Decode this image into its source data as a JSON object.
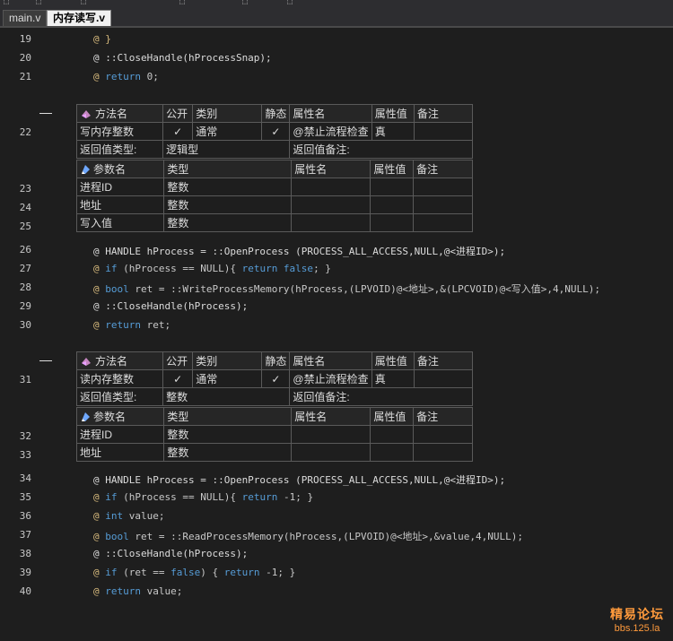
{
  "tabs": {
    "inactive": "main.v",
    "active": "内存读写.v"
  },
  "lines": {
    "l19": {
      "n": "19",
      "text": "@ }"
    },
    "l20": {
      "n": "20",
      "text": "@ ::CloseHandle(hProcessSnap);"
    },
    "l21": {
      "n": "21",
      "at": "@ ",
      "kw": "return",
      "rest": " 0;"
    },
    "l26": {
      "n": "26",
      "text": "@ HANDLE hProcess = ::OpenProcess (PROCESS_ALL_ACCESS,NULL,@<进程ID>);"
    },
    "l27": {
      "n": "27",
      "at": "@ ",
      "kw": "if",
      "mid": " (hProcess == NULL){ ",
      "kw2": "return false",
      "rest": "; }"
    },
    "l28": {
      "n": "28",
      "at": "@ ",
      "kw": "bool",
      "rest": " ret = ::WriteProcessMemory(hProcess,(LPVOID)@<地址>,&(LPCVOID)@<写入值>,4,NULL);"
    },
    "l29": {
      "n": "29",
      "text": "@ ::CloseHandle(hProcess);"
    },
    "l30": {
      "n": "30",
      "at": "@ ",
      "kw": "return",
      "rest": " ret;"
    },
    "l34": {
      "n": "34",
      "text": "@ HANDLE hProcess = ::OpenProcess (PROCESS_ALL_ACCESS,NULL,@<进程ID>);"
    },
    "l35": {
      "n": "35",
      "at": "@ ",
      "kw": "if",
      "mid": " (hProcess == NULL){ ",
      "kw2": "return",
      "rest": " -1; }"
    },
    "l36": {
      "n": "36",
      "at": "@ ",
      "kw": "int",
      "rest": " value;"
    },
    "l37": {
      "n": "37",
      "at": "@ ",
      "kw": "bool",
      "rest": " ret = ::ReadProcessMemory(hProcess,(LPVOID)@<地址>,&value,4,NULL);"
    },
    "l38": {
      "n": "38",
      "text": "@ ::CloseHandle(hProcess);"
    },
    "l39": {
      "n": "39",
      "at": "@ ",
      "kw": "if",
      "mid": " (ret == ",
      "kw2": "false",
      "mid2": ") { ",
      "kw3": "return",
      "rest": " -1; }"
    },
    "l40": {
      "n": "40",
      "at": "@ ",
      "kw": "return",
      "rest": " value;"
    }
  },
  "method_headers": {
    "method_name": "方法名",
    "public": "公开",
    "category": "类别",
    "static": "静态",
    "attr_name": "属性名",
    "attr_value": "属性值",
    "remark": "备注",
    "return_type": "返回值类型:",
    "return_remark": "返回值备注:",
    "param_name": "参数名",
    "type": "类型"
  },
  "method1": {
    "line": "22",
    "name": "写内存整数",
    "category": "通常",
    "attr": "@禁止流程检查",
    "attr_value": "真",
    "return_type": "逻辑型",
    "params": [
      {
        "line": "23",
        "name": "进程ID",
        "type": "整数"
      },
      {
        "line": "24",
        "name": "地址",
        "type": "整数"
      },
      {
        "line": "25",
        "name": "写入值",
        "type": "整数"
      }
    ]
  },
  "method2": {
    "line": "31",
    "name": "读内存整数",
    "category": "通常",
    "attr": "@禁止流程检查",
    "attr_value": "真",
    "return_type": "整数",
    "params": [
      {
        "line": "32",
        "name": "进程ID",
        "type": "整数"
      },
      {
        "line": "33",
        "name": "地址",
        "type": "整数"
      }
    ]
  },
  "check_mark": "✓",
  "watermark": {
    "title": "精易论坛",
    "url": "bbs.125.la"
  }
}
